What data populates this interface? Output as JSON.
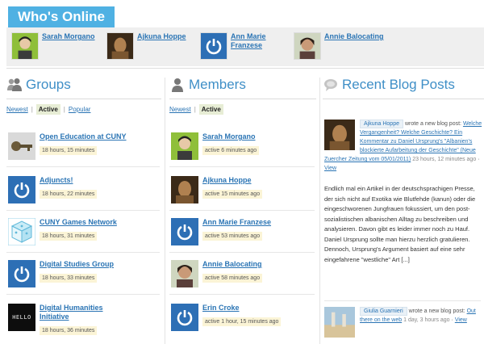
{
  "whos_online": {
    "title": "Who's Online",
    "users": [
      {
        "name": "Sarah Morgano"
      },
      {
        "name": "Ajkuna Hoppe"
      },
      {
        "name": "Ann Marie Franzese"
      },
      {
        "name": "Annie Balocating"
      }
    ]
  },
  "groups": {
    "title": "Groups",
    "filters": {
      "newest": "Newest",
      "active": "Active",
      "popular": "Popular"
    },
    "items": [
      {
        "name": "Open Education at CUNY",
        "meta": "18 hours, 15 minutes"
      },
      {
        "name": "Adjuncts!",
        "meta": "18 hours, 22 minutes"
      },
      {
        "name": "CUNY Games Network",
        "meta": "18 hours, 31 minutes"
      },
      {
        "name": "Digital Studies Group",
        "meta": "18 hours, 33 minutes"
      },
      {
        "name": "Digital Humanities Initiative",
        "meta": "18 hours, 36 minutes",
        "logo_text": "HELLO"
      }
    ]
  },
  "members": {
    "title": "Members",
    "filters": {
      "newest": "Newest",
      "active": "Active"
    },
    "items": [
      {
        "name": "Sarah Morgano",
        "meta": "active 6 minutes ago"
      },
      {
        "name": "Ajkuna Hoppe",
        "meta": "active 15 minutes ago"
      },
      {
        "name": "Ann Marie Franzese",
        "meta": "active 53 minutes ago"
      },
      {
        "name": "Annie Balocating",
        "meta": "active 58 minutes ago"
      },
      {
        "name": "Erin Croke",
        "meta": "active 1 hour, 15 minutes ago"
      }
    ]
  },
  "blog": {
    "title": "Recent Blog Posts",
    "posts": [
      {
        "author": "Ajkuna Hoppe",
        "action": "wrote a new blog post:",
        "title": "Welche Vergangenheit? Welche Geschichte? Ein Kommentar zu Daniel Ursprung's \"Albanien's blockierte Aufarbeitung der Geschichte\" (Neue Zuercher Zeitung vom 05/01/2011)",
        "when": "23 hours, 12 minutes ago",
        "view": "View",
        "body": "Endlich mal ein Artikel  in der deutschsprachigen Presse, der sich nicht auf Exotika wie Blutfehde (kanun) oder die eingeschworenen Jungfrauen fokussiert, um den post-sozialistischen albanischen Alltag zu beschreiben und analysieren. Davon gibt es leider immer noch zu Hauf. Daniel Ursprung sollte man hierzu herzlich gratulieren. Dennoch, Ursprung's Argument basiert auf eine sehr eingefahrene \"westliche\" Art [...]"
      },
      {
        "author": "Giulia Guarnieri",
        "action": "wrote a new blog post:",
        "title": "Out there on the web",
        "when": "1 day, 3 hours ago",
        "view": "View"
      }
    ]
  },
  "colors": {
    "accent": "#4fb1e3",
    "link": "#2a74b4",
    "heading": "#3f8fc7",
    "tile_blue": "#2d6fb5",
    "meta_bg": "#fbf4d6"
  }
}
